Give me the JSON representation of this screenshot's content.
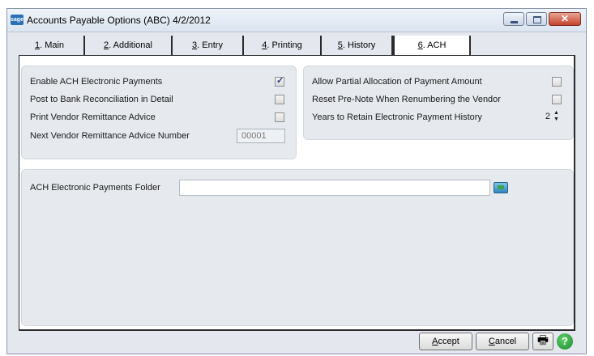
{
  "window": {
    "title": "Accounts Payable Options (ABC) 4/2/2012",
    "icon_text": "sage"
  },
  "tabs": [
    {
      "key": "1",
      "label": ". Main",
      "active": false
    },
    {
      "key": "2",
      "label": ". Additional",
      "active": false
    },
    {
      "key": "3",
      "label": ". Entry",
      "active": false
    },
    {
      "key": "4",
      "label": ". Printing",
      "active": false
    },
    {
      "key": "5",
      "label": ". History",
      "active": false
    },
    {
      "key": "6",
      "label": ". ACH",
      "active": true
    }
  ],
  "left_group": {
    "enable_ach": {
      "label": "Enable ACH Electronic Payments",
      "checked": true
    },
    "post_bank_rec": {
      "label": "Post to Bank Reconciliation in Detail",
      "checked": false
    },
    "print_remittance": {
      "label": "Print Vendor Remittance Advice",
      "checked": false
    },
    "next_remittance": {
      "label": "Next Vendor Remittance Advice Number",
      "value": "00001"
    }
  },
  "right_group": {
    "partial_allocation": {
      "label": "Allow Partial Allocation of Payment Amount",
      "checked": false
    },
    "reset_prenote": {
      "label": "Reset Pre-Note When Renumbering the Vendor",
      "checked": false
    },
    "years_retain": {
      "label": "Years to Retain Electronic Payment History",
      "value": "2"
    }
  },
  "folder_group": {
    "label": "ACH Electronic Payments Folder",
    "value": ""
  },
  "buttons": {
    "accept_key": "A",
    "accept_rest": "ccept",
    "cancel_key": "C",
    "cancel_rest": "ancel"
  },
  "colors": {
    "accent": "#2b6fb8",
    "close": "#c4432c",
    "help": "#1c8a2c"
  }
}
